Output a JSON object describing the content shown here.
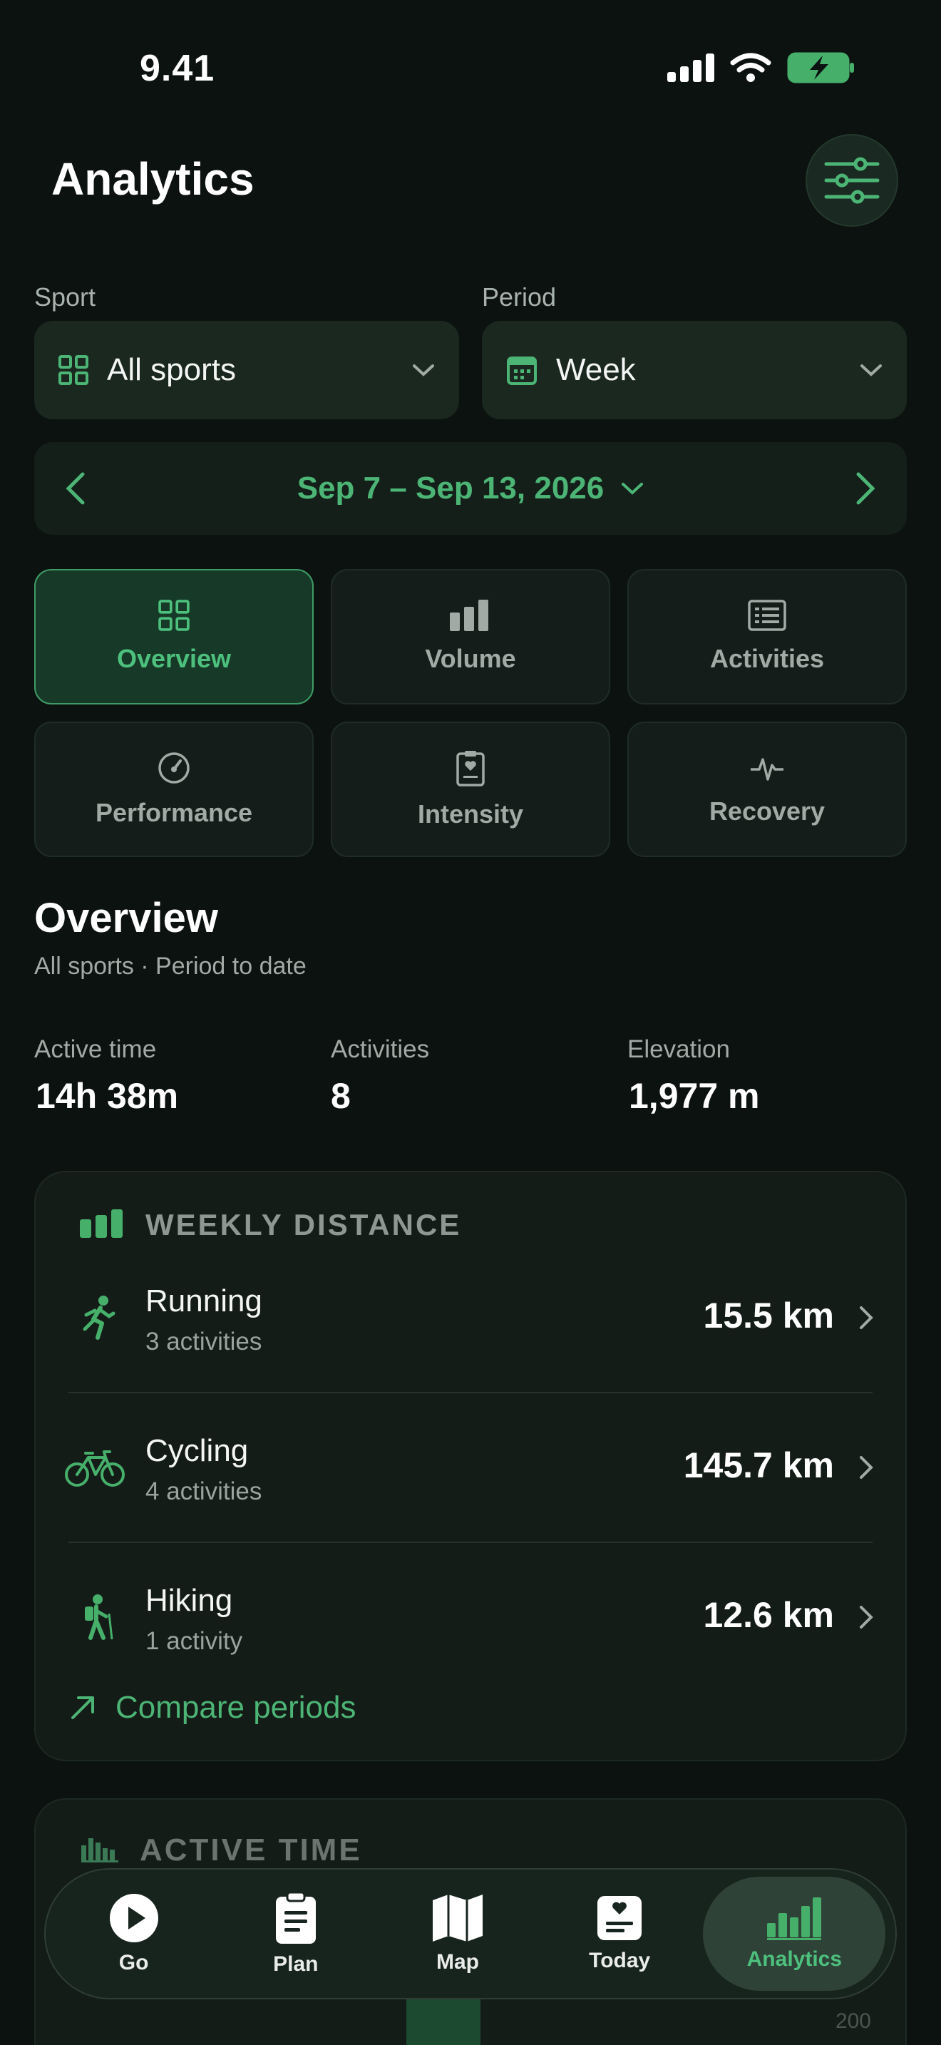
{
  "status_bar": {
    "time": "9.41"
  },
  "header": {
    "title": "Analytics"
  },
  "filters": {
    "sport_label": "Sport",
    "sport_value": "All sports",
    "period_label": "Period",
    "period_value": "Week"
  },
  "date_range": {
    "label": "Sep 7 – Sep 13, 2026"
  },
  "tabs": [
    {
      "label": "Overview",
      "icon": "grid-icon",
      "active": true
    },
    {
      "label": "Volume",
      "icon": "bar-chart-icon",
      "active": false
    },
    {
      "label": "Activities",
      "icon": "list-icon",
      "active": false
    },
    {
      "label": "Performance",
      "icon": "gauge-icon",
      "active": false
    },
    {
      "label": "Intensity",
      "icon": "clipboard-heart-icon",
      "active": false
    },
    {
      "label": "Recovery",
      "icon": "pulse-icon",
      "active": false
    }
  ],
  "overview": {
    "title": "Overview",
    "subtitle": "All sports · Period to date",
    "stats": [
      {
        "label": "Active time",
        "value": "14h 38m"
      },
      {
        "label": "Activities",
        "value": "8"
      },
      {
        "label": "Elevation",
        "value": "1,977 m"
      }
    ]
  },
  "weekly_distance": {
    "title": "WEEKLY DISTANCE",
    "rows": [
      {
        "name": "Running",
        "sub": "3 activities",
        "value": "15.5 km",
        "icon": "running-icon"
      },
      {
        "name": "Cycling",
        "sub": "4 activities",
        "value": "145.7 km",
        "icon": "bicycle-icon"
      },
      {
        "name": "Hiking",
        "sub": "1 activity",
        "value": "12.6 km",
        "icon": "hiking-icon"
      }
    ],
    "compare_label": "Compare periods"
  },
  "active_time": {
    "title": "ACTIVE TIME",
    "axis_tick": "200"
  },
  "nav": [
    {
      "label": "Go",
      "icon": "play-icon",
      "active": false
    },
    {
      "label": "Plan",
      "icon": "clipboard-icon",
      "active": false
    },
    {
      "label": "Map",
      "icon": "map-icon",
      "active": false
    },
    {
      "label": "Today",
      "icon": "today-icon",
      "active": false
    },
    {
      "label": "Analytics",
      "icon": "analytics-icon",
      "active": true
    }
  ],
  "colors": {
    "accent": "#4cb575",
    "background": "#0c1210",
    "card": "#141c18"
  }
}
